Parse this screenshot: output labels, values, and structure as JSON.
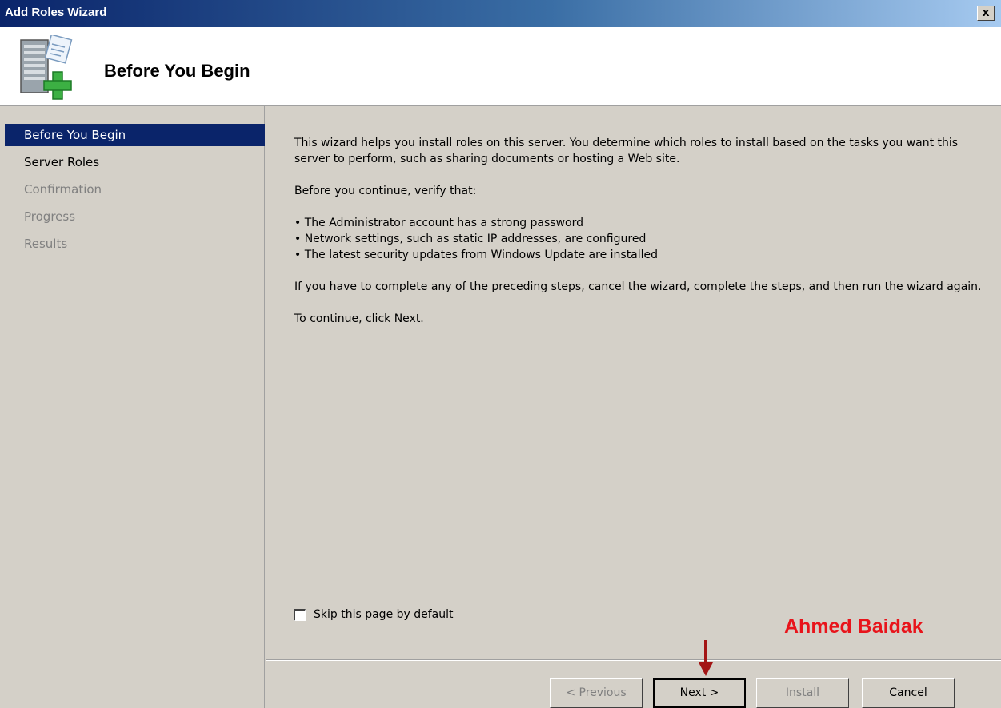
{
  "window": {
    "title": "Add Roles Wizard",
    "close_label": "x"
  },
  "header": {
    "title": "Before You Begin",
    "icon": "server-add-icon"
  },
  "steps": [
    {
      "label": "Before You Begin",
      "state": "active"
    },
    {
      "label": "Server Roles",
      "state": "normal"
    },
    {
      "label": "Confirmation",
      "state": "disabled"
    },
    {
      "label": "Progress",
      "state": "disabled"
    },
    {
      "label": "Results",
      "state": "disabled"
    }
  ],
  "content": {
    "intro": "This wizard helps you install roles on this server. You determine which roles to install based on the tasks you want this server to perform, such as sharing documents or hosting a Web site.",
    "verify_heading": "Before you continue, verify that:",
    "bullets": [
      "• The Administrator account has a strong password",
      "• Network settings, such as static IP addresses, are configured",
      "• The latest security updates from Windows Update are installed"
    ],
    "note": "If you have to complete any of the preceding steps, cancel the wizard, complete the steps, and then run the wizard again.",
    "continue_text": "To continue, click Next."
  },
  "skip_checkbox": {
    "label": "Skip this page by default",
    "checked": false
  },
  "watermark": "Ahmed Baidak",
  "buttons": {
    "previous": "< Previous",
    "next": "Next >",
    "install": "Install",
    "cancel": "Cancel"
  },
  "colors": {
    "selection": "#0a246a",
    "annotation": "#e8141b",
    "arrow": "#a31515"
  }
}
